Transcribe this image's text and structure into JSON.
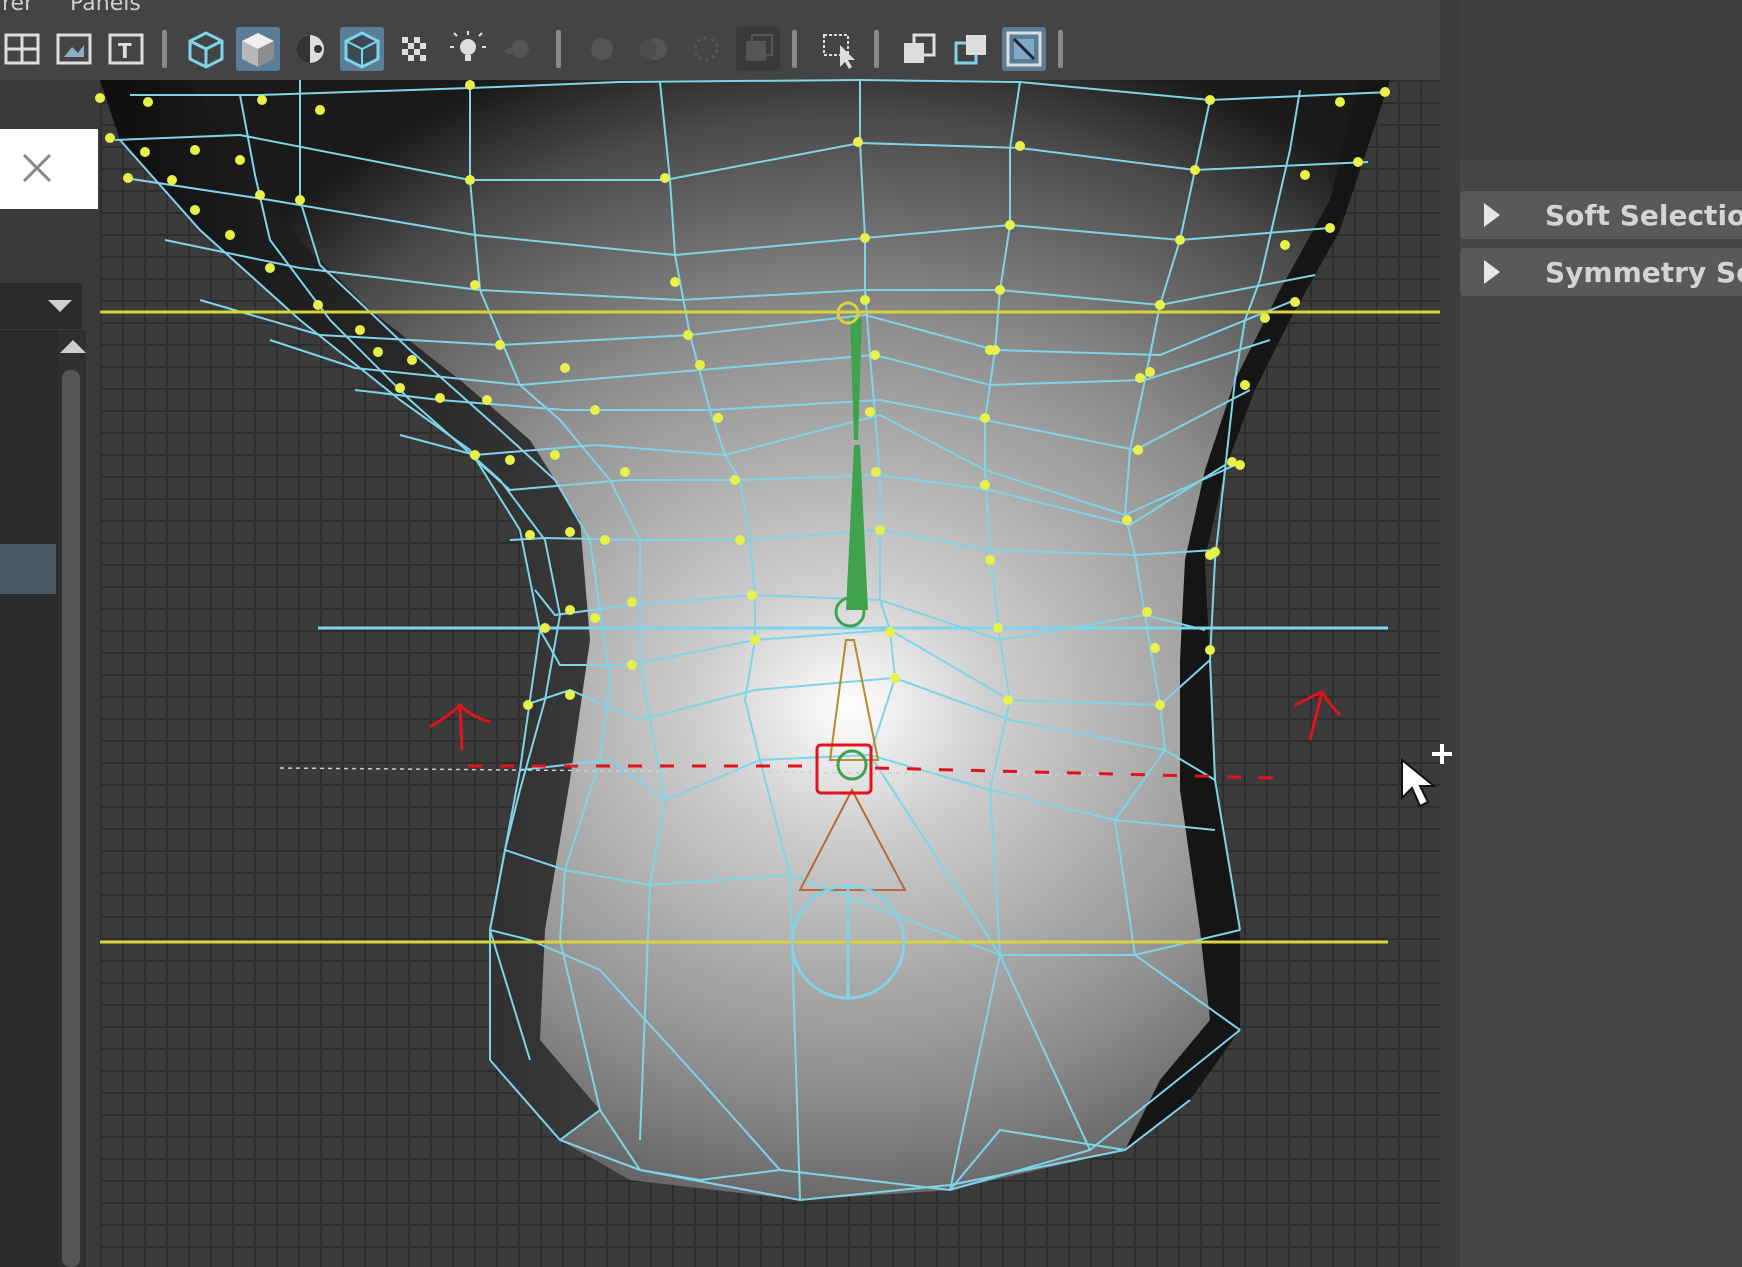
{
  "menubar": {
    "items": [
      "rer",
      "Panels"
    ]
  },
  "toolbar": {
    "icons": [
      "quad-view-icon",
      "image-plane-icon",
      "texture-icon",
      "wireframe-cube-icon",
      "shaded-cube-icon",
      "lighting-icon",
      "wireframe-on-shaded-icon",
      "checker-icon",
      "light-bulb-icon",
      "shadows-icon",
      "ambient-occlusion-icon",
      "motion-blur-icon",
      "anti-alias-icon",
      "depth-of-field-icon",
      "isolate-select-icon",
      "xray-icon",
      "xray-joints-icon",
      "xray-active-icon"
    ]
  },
  "attribute_panel": {
    "sections": [
      "Soft Selection",
      "Symmetry Sett"
    ]
  },
  "colors": {
    "wire": "#7fd4ea",
    "vertex": "#e8f04a",
    "guide_yellow": "#d9d43a",
    "annotation_red": "#e0141a",
    "joint_green": "#3fa34d"
  }
}
